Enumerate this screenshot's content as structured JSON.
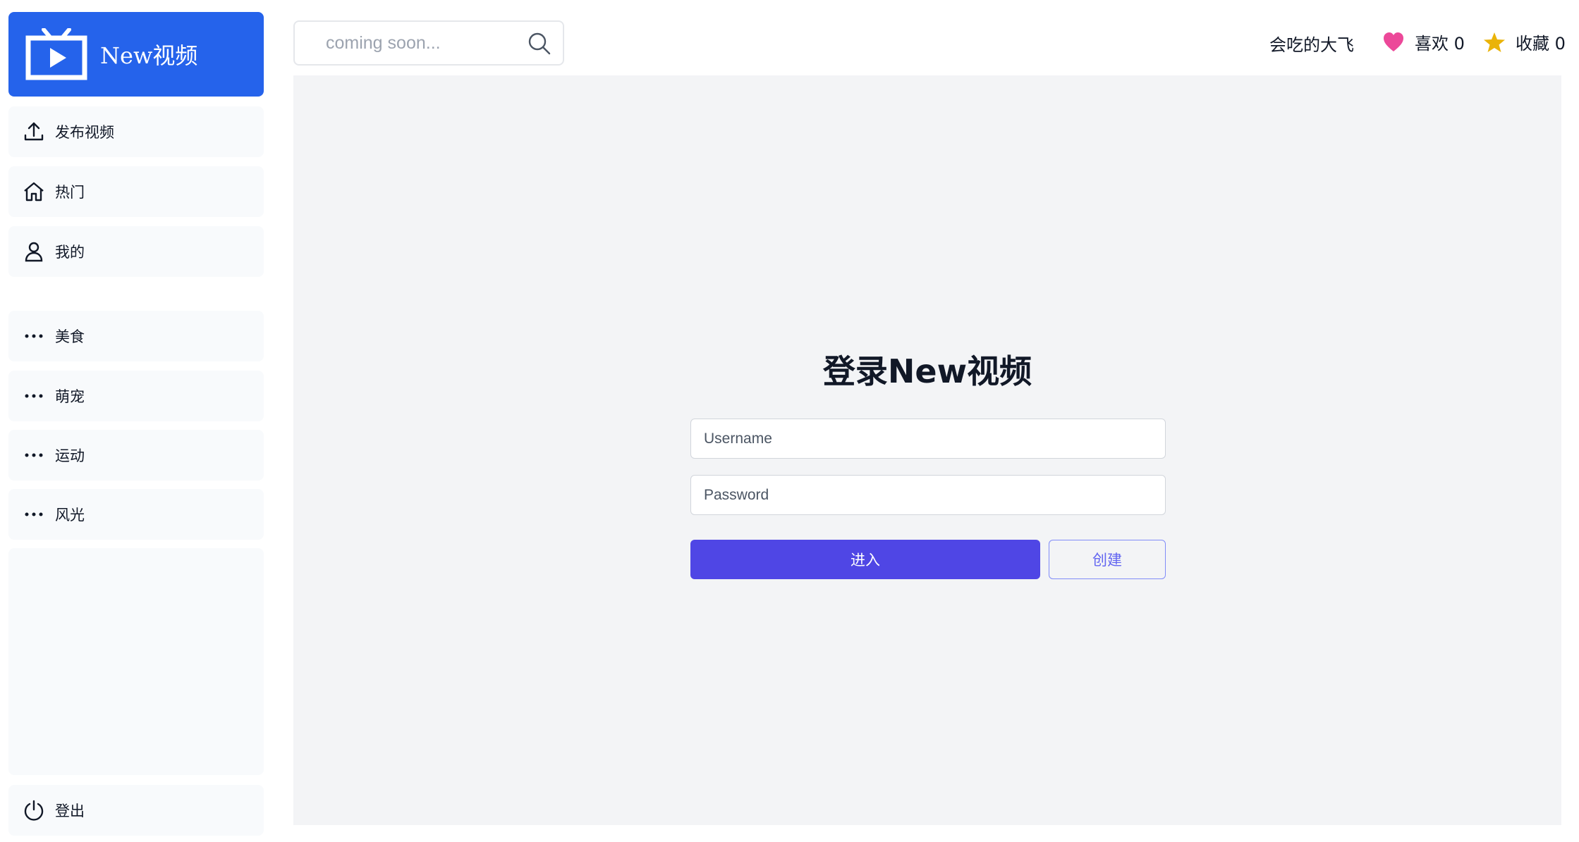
{
  "app": {
    "name": "New视频"
  },
  "sidebar": {
    "top_items": [
      {
        "label": "发布视频",
        "icon": "upload-icon"
      },
      {
        "label": "热门",
        "icon": "home-icon"
      },
      {
        "label": "我的",
        "icon": "user-icon"
      }
    ],
    "category_items": [
      {
        "label": "美食",
        "icon": "more-dots-icon"
      },
      {
        "label": "萌宠",
        "icon": "more-dots-icon"
      },
      {
        "label": "运动",
        "icon": "more-dots-icon"
      },
      {
        "label": "风光",
        "icon": "more-dots-icon"
      }
    ],
    "logout": {
      "label": "登出",
      "icon": "power-icon"
    }
  },
  "header": {
    "search": {
      "placeholder": "coming soon...",
      "value": ""
    },
    "user_name": "会吃的大飞",
    "likes_label": "喜欢 0",
    "favorites_label": "收藏 0"
  },
  "login": {
    "title": "登录New视频",
    "username_placeholder": "Username",
    "password_placeholder": "Password",
    "submit_label": "进入",
    "create_label": "创建"
  },
  "colors": {
    "brand": "#2563eb",
    "primary_button": "#4f46e5",
    "secondary_button": "#6366f1",
    "like_heart": "#ec4899",
    "favorite_star": "#eab308",
    "main_background": "#f3f4f6",
    "sidebar_item_background": "#f8fafc"
  }
}
